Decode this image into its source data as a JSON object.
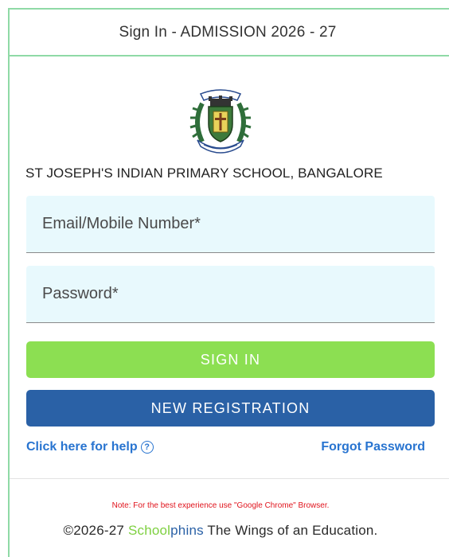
{
  "header": {
    "title": "Sign In - ADMISSION 2026 - 27"
  },
  "school": {
    "logo_icon": "school-crest-icon",
    "name": "ST JOSEPH'S INDIAN PRIMARY SCHOOL, BANGALORE"
  },
  "form": {
    "email_placeholder": "Email/Mobile Number*",
    "email_value": "",
    "password_placeholder": "Password*",
    "password_value": ""
  },
  "buttons": {
    "sign_in": "SIGN IN",
    "new_registration": "NEW REGISTRATION"
  },
  "links": {
    "help": "Click here for help",
    "help_icon": "question-circle-icon",
    "forgot": "Forgot Password"
  },
  "footer": {
    "note": "Note: For the best experience use \"Google Chrome\" Browser.",
    "copyright": "©2026-27",
    "brand_part1": "School",
    "brand_part2": "phins",
    "tagline": "The Wings of an Education."
  },
  "colors": {
    "border": "#8fdaa6",
    "field_bg": "#e8f9fd",
    "sign_in_bg": "#8cdf52",
    "register_bg": "#2a61a6",
    "link": "#2874d0",
    "note": "#e0131c"
  }
}
